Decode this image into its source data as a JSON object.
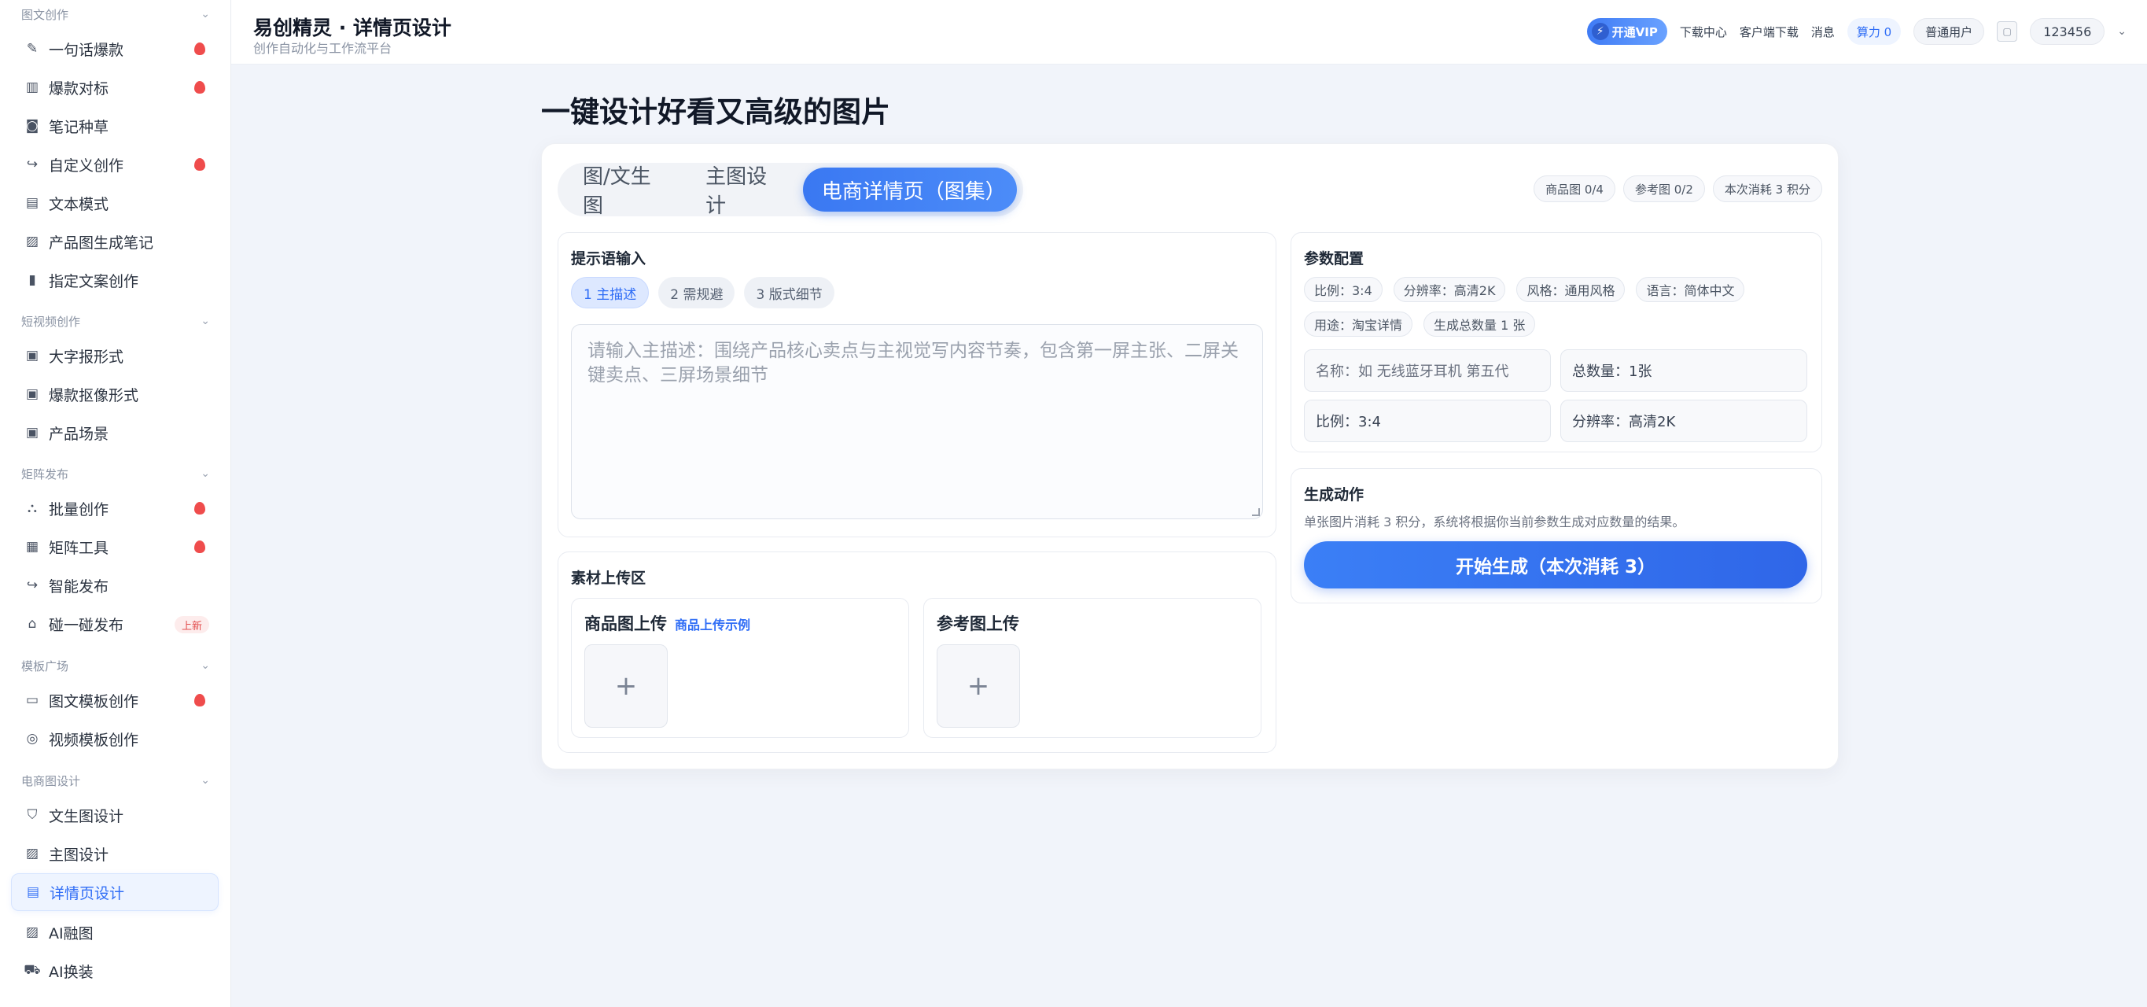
{
  "sidebar": {
    "sections": [
      {
        "title": "图文创作",
        "items": [
          {
            "label": "一句话爆款",
            "icon": "pencil-icon",
            "hot": true
          },
          {
            "label": "爆款对标",
            "icon": "bar-chart-icon",
            "hot": true
          },
          {
            "label": "笔记种草",
            "icon": "camera-icon",
            "hot": false
          },
          {
            "label": "自定义创作",
            "icon": "share-arrow-icon",
            "hot": true
          },
          {
            "label": "文本模式",
            "icon": "document-icon",
            "hot": false
          },
          {
            "label": "产品图生成笔记",
            "icon": "image-icon",
            "hot": false
          },
          {
            "label": "指定文案创作",
            "icon": "file-icon",
            "hot": false
          }
        ]
      },
      {
        "title": "短视频创作",
        "items": [
          {
            "label": "大字报形式",
            "icon": "calendar-icon",
            "hot": false
          },
          {
            "label": "爆款抠像形式",
            "icon": "calendar-icon",
            "hot": false
          },
          {
            "label": "产品场景",
            "icon": "calendar-icon",
            "hot": false
          }
        ]
      },
      {
        "title": "矩阵发布",
        "items": [
          {
            "label": "批量创作",
            "icon": "sitemap-icon",
            "hot": true
          },
          {
            "label": "矩阵工具",
            "icon": "grid-icon",
            "hot": true
          },
          {
            "label": "智能发布",
            "icon": "share-arrow-icon",
            "hot": false
          },
          {
            "label": "碰一碰发布",
            "icon": "home-icon",
            "hot": false,
            "tag": "上新"
          }
        ]
      },
      {
        "title": "模板广场",
        "items": [
          {
            "label": "图文模板创作",
            "icon": "template-icon",
            "hot": true
          },
          {
            "label": "视频模板创作",
            "icon": "video-template-icon",
            "hot": false
          }
        ]
      },
      {
        "title": "电商图设计",
        "items": [
          {
            "label": "文生图设计",
            "icon": "brush-icon",
            "hot": false
          },
          {
            "label": "主图设计",
            "icon": "picture-icon",
            "hot": false
          },
          {
            "label": "详情页设计",
            "icon": "detail-page-icon",
            "hot": false,
            "active": true
          },
          {
            "label": "AI融图",
            "icon": "picture-icon",
            "hot": false
          },
          {
            "label": "AI换装",
            "icon": "cart-icon",
            "hot": false
          }
        ]
      }
    ]
  },
  "header": {
    "title": "易创精灵 · 详情页设计",
    "subtitle": "创作自动化与工作流平台",
    "vip_label": "开通VIP",
    "links": [
      "下载中心",
      "客户端下载",
      "消息"
    ],
    "power_label": "算力 0",
    "user_level": "普通用户",
    "username": "123456"
  },
  "main": {
    "heading": "一键设计好看又高级的图片",
    "tabs": [
      {
        "label": "图/文生图",
        "active": false
      },
      {
        "label": "主图设计",
        "active": false
      },
      {
        "label": "电商详情页（图集）",
        "active": true
      }
    ],
    "counts": [
      "商品图 0/4",
      "参考图 0/2",
      "本次消耗 3 积分"
    ],
    "prompt": {
      "title": "提示语输入",
      "steps": [
        {
          "label": "1 主描述",
          "active": true
        },
        {
          "label": "2 需规避",
          "active": false
        },
        {
          "label": "3 版式细节",
          "active": false
        }
      ],
      "placeholder": "请输入主描述：围绕产品核心卖点与主视觉写内容节奏，包含第一屏主张、二屏关键卖点、三屏场景细节"
    },
    "upload": {
      "title": "素材上传区",
      "product": {
        "title": "商品图上传",
        "link": "商品上传示例",
        "plus": "+"
      },
      "reference": {
        "title": "参考图上传",
        "plus": "+"
      }
    },
    "params": {
      "title": "参数配置",
      "chips": [
        "比例：3:4",
        "分辨率：高清2K",
        "风格：通用风格",
        "语言：简体中文",
        "用途：淘宝详情",
        "生成总数量 1 张"
      ],
      "name_placeholder": "名称：如 无线蓝牙耳机 第五代",
      "total": "总数量：1张",
      "ratio": "比例：3:4",
      "resolution": "分辨率：高清2K"
    },
    "generate": {
      "title": "生成动作",
      "desc": "单张图片消耗 3 积分，系统将根据你当前参数生成对应数量的结果。",
      "button": "开始生成（本次消耗 3）"
    }
  },
  "colors": {
    "accent": "#2f6df6",
    "hot": "#ef4c4c",
    "page_bg": "#f1f4fa"
  }
}
